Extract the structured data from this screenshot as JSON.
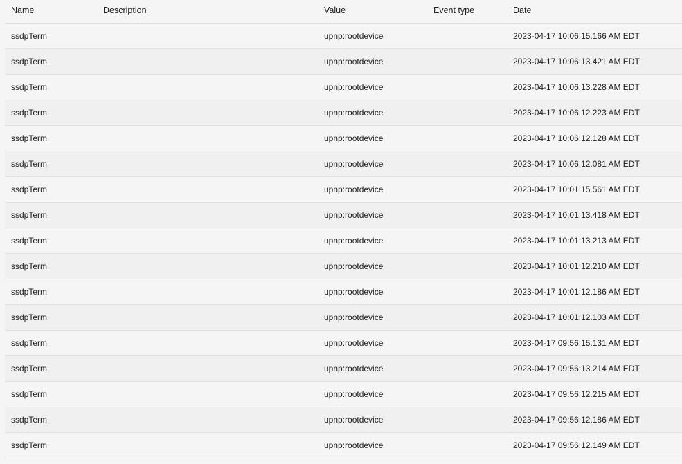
{
  "table": {
    "headers": {
      "name": "Name",
      "description": "Description",
      "value": "Value",
      "event_type": "Event type",
      "date": "Date"
    },
    "rows": [
      {
        "name": "ssdpTerm",
        "description": "",
        "value": "upnp:rootdevice",
        "event_type": "",
        "date": "2023-04-17 10:06:15.166 AM EDT"
      },
      {
        "name": "ssdpTerm",
        "description": "",
        "value": "upnp:rootdevice",
        "event_type": "",
        "date": "2023-04-17 10:06:13.421 AM EDT"
      },
      {
        "name": "ssdpTerm",
        "description": "",
        "value": "upnp:rootdevice",
        "event_type": "",
        "date": "2023-04-17 10:06:13.228 AM EDT"
      },
      {
        "name": "ssdpTerm",
        "description": "",
        "value": "upnp:rootdevice",
        "event_type": "",
        "date": "2023-04-17 10:06:12.223 AM EDT"
      },
      {
        "name": "ssdpTerm",
        "description": "",
        "value": "upnp:rootdevice",
        "event_type": "",
        "date": "2023-04-17 10:06:12.128 AM EDT"
      },
      {
        "name": "ssdpTerm",
        "description": "",
        "value": "upnp:rootdevice",
        "event_type": "",
        "date": "2023-04-17 10:06:12.081 AM EDT"
      },
      {
        "name": "ssdpTerm",
        "description": "",
        "value": "upnp:rootdevice",
        "event_type": "",
        "date": "2023-04-17 10:01:15.561 AM EDT"
      },
      {
        "name": "ssdpTerm",
        "description": "",
        "value": "upnp:rootdevice",
        "event_type": "",
        "date": "2023-04-17 10:01:13.418 AM EDT"
      },
      {
        "name": "ssdpTerm",
        "description": "",
        "value": "upnp:rootdevice",
        "event_type": "",
        "date": "2023-04-17 10:01:13.213 AM EDT"
      },
      {
        "name": "ssdpTerm",
        "description": "",
        "value": "upnp:rootdevice",
        "event_type": "",
        "date": "2023-04-17 10:01:12.210 AM EDT"
      },
      {
        "name": "ssdpTerm",
        "description": "",
        "value": "upnp:rootdevice",
        "event_type": "",
        "date": "2023-04-17 10:01:12.186 AM EDT"
      },
      {
        "name": "ssdpTerm",
        "description": "",
        "value": "upnp:rootdevice",
        "event_type": "",
        "date": "2023-04-17 10:01:12.103 AM EDT"
      },
      {
        "name": "ssdpTerm",
        "description": "",
        "value": "upnp:rootdevice",
        "event_type": "",
        "date": "2023-04-17 09:56:15.131 AM EDT"
      },
      {
        "name": "ssdpTerm",
        "description": "",
        "value": "upnp:rootdevice",
        "event_type": "",
        "date": "2023-04-17 09:56:13.214 AM EDT"
      },
      {
        "name": "ssdpTerm",
        "description": "",
        "value": "upnp:rootdevice",
        "event_type": "",
        "date": "2023-04-17 09:56:12.215 AM EDT"
      },
      {
        "name": "ssdpTerm",
        "description": "",
        "value": "upnp:rootdevice",
        "event_type": "",
        "date": "2023-04-17 09:56:12.186 AM EDT"
      },
      {
        "name": "ssdpTerm",
        "description": "",
        "value": "upnp:rootdevice",
        "event_type": "",
        "date": "2023-04-17 09:56:12.149 AM EDT"
      }
    ]
  },
  "colors": {
    "row_even": "#f5f5f5",
    "row_odd": "#f0f0f0",
    "divider": "#e0e0e0",
    "text": "#212121"
  }
}
